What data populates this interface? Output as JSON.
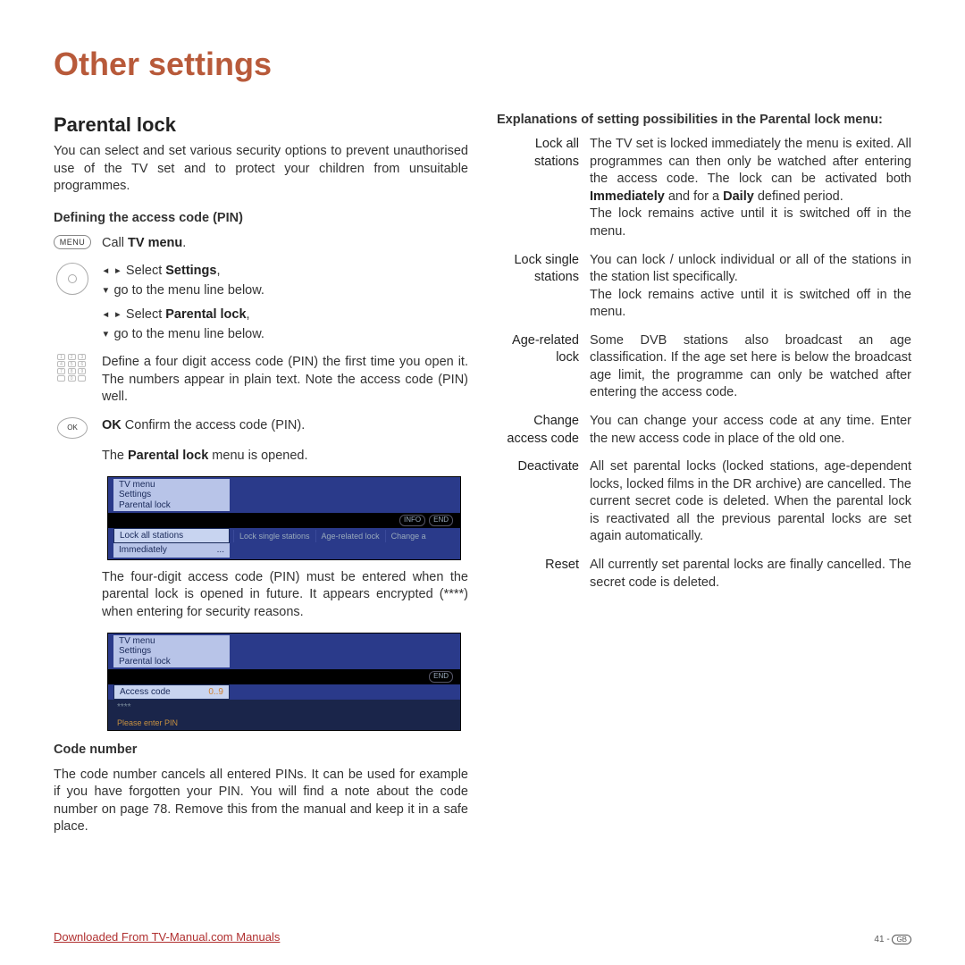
{
  "page_title": "Other settings",
  "left": {
    "section_title": "Parental lock",
    "intro": "You can select and set various security options to prevent unauthorised use of the TV set and to protect your children from unsuitable programmes.",
    "sub1": "Defining the access code (PIN)",
    "menu_label": "MENU",
    "step1_pre": "Call ",
    "step1_bold": "TV menu",
    "step1_post": ".",
    "step2a_pre": "Select ",
    "step2a_bold": "Settings",
    "step2a_post": ",",
    "step2b": "go to the menu line below.",
    "step3a_pre": "Select ",
    "step3a_bold": "Parental lock",
    "step3a_post": ",",
    "step3b": "go to the menu line below.",
    "step4": "Define a four digit access code (PIN) the first time you open it. The numbers appear in plain text. Note the access code (PIN) well.",
    "ok_label": "OK",
    "step5_bold": "OK",
    "step5_post": "  Confirm the access code (PIN).",
    "opened_pre": "The ",
    "opened_bold": "Parental lock",
    "opened_post": " menu is opened.",
    "tv1": {
      "l1": "TV menu",
      "l2": "Settings",
      "l3": "Parental lock",
      "highlight": "Lock all stations",
      "tabs": [
        "Lock single stations",
        "Age-related lock",
        "Change a"
      ],
      "last": "Immediately",
      "last_dots": "...",
      "badges": [
        "INFO",
        "END"
      ]
    },
    "after_tv1": "The four-digit access code (PIN) must be entered when the parental lock is opened in future. It appears encrypted (****) when entering for security reasons.",
    "tv2": {
      "l1": "TV menu",
      "l2": "Settings",
      "l3": "Parental lock",
      "highlight": "Access code",
      "pin": "****",
      "pin_hint": "0..9",
      "prompt": "Please enter PIN",
      "badge": "END"
    },
    "sub2": "Code number",
    "codenum": "The code number cancels all entered PINs. It can be used for example if you have forgotten your PIN. You will find a note about the code number on page 78. Remove this from the manual and keep it in a safe place."
  },
  "right": {
    "heading": "Explanations of setting possibilities in the Parental lock menu:",
    "items": [
      {
        "term1": "Lock all",
        "term2": "stations",
        "d1": "The TV set is locked immediately the menu is exited. All programmes can then only be watched after entering the access code. The lock can be activated both ",
        "d1b": "Immediately",
        "d2": " and for a ",
        "d2b": "Daily",
        "d3": " defined period.",
        "d4": "The lock remains active until it is switched off in the menu."
      },
      {
        "term1": "Lock single",
        "term2": "stations",
        "d1": "You can lock / unlock individual or all of the stations in the station list specifically.",
        "d4": "The lock remains active until it is switched off in the menu."
      },
      {
        "term1": "Age-related",
        "term2": "lock",
        "d1": "Some DVB stations also broadcast an age classification. If the age set here is below the broadcast age limit, the programme can only be watched after entering the access code."
      },
      {
        "term1": "Change",
        "term2": "access code",
        "d1": "You can change your access code at any time. Enter the new access code in place of the old one."
      },
      {
        "term1": "Deactivate",
        "term2": "",
        "d1": "All set parental locks (locked stations, age-dependent locks, locked films in the DR archive) are cancelled. The current secret code is deleted. When the parental lock is reactivated all the previous parental locks are set again automatically."
      },
      {
        "term1": "Reset",
        "term2": "",
        "d1": "All currently set parental locks are finally cancelled. The secret code is deleted."
      }
    ]
  },
  "footer_link": "Downloaded From TV-Manual.com Manuals",
  "page_number": "41 - ",
  "page_region": "GB"
}
